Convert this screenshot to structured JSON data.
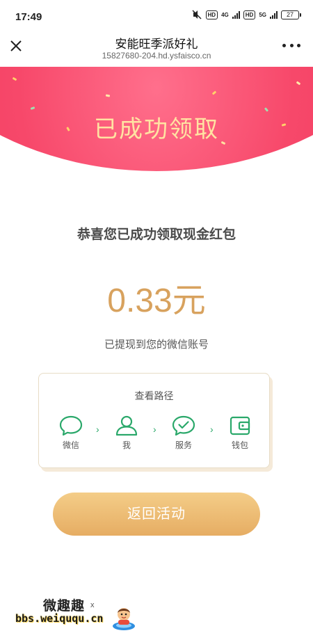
{
  "status_bar": {
    "time": "17:49",
    "net1": "4G",
    "hd1": "HD",
    "hd2": "HD",
    "net2": "5G",
    "battery": "27"
  },
  "nav": {
    "title": "安能旺季派好礼",
    "url": "15827680-204.hd.ysfaisco.cn"
  },
  "banner": {
    "title": "已成功领取"
  },
  "content": {
    "congrats": "恭喜您已成功领取现金红包",
    "amount": "0.33元",
    "withdraw_note": "已提现到您的微信账号"
  },
  "path_card": {
    "title": "查看路径",
    "steps": [
      {
        "label": "微信",
        "icon": "chat-bubble-icon"
      },
      {
        "label": "我",
        "icon": "user-icon"
      },
      {
        "label": "服务",
        "icon": "check-bubble-icon"
      },
      {
        "label": "钱包",
        "icon": "wallet-icon"
      }
    ],
    "arrow": "›",
    "accent_color": "#2aa86a"
  },
  "return_button": {
    "label": "返回活动"
  },
  "watermark": {
    "text": "微趣趣",
    "url": "bbs.weiququ.cn",
    "mark": "x"
  },
  "colors": {
    "banner": "#f03a5e",
    "banner_text": "#ffe3a2",
    "amount": "#d8a25e",
    "button": "#e6ad63"
  }
}
